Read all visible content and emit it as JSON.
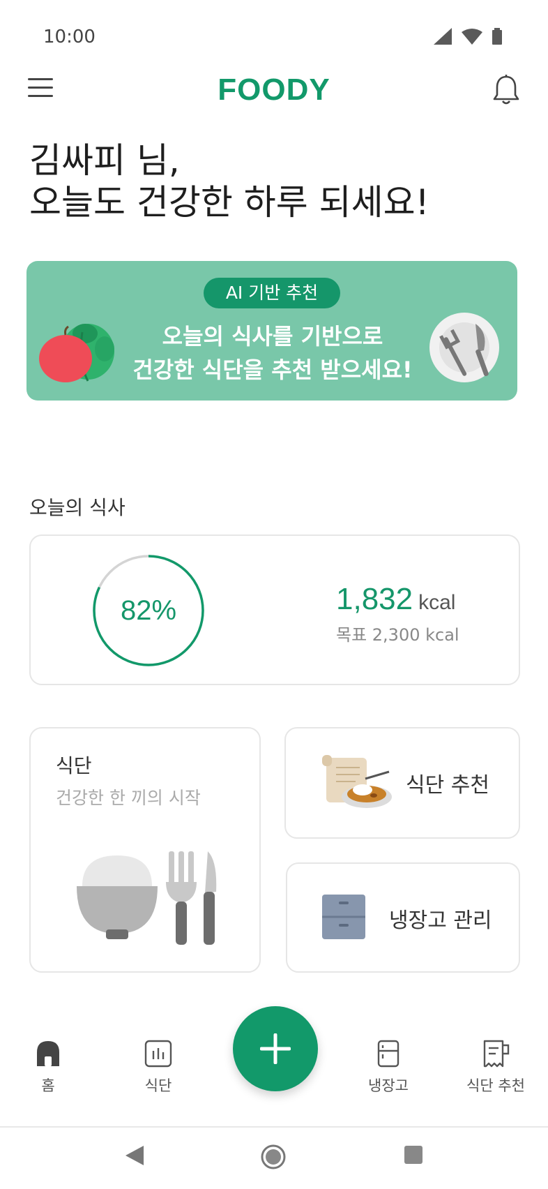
{
  "status_bar": {
    "time": "10:00"
  },
  "header": {
    "logo": "FOODY"
  },
  "greeting": {
    "line1": "김싸피 님,",
    "line2": "오늘도 건강한 하루 되세요!"
  },
  "banner": {
    "chip": "AI 기반 추천",
    "line1": "오늘의 식사를 기반으로",
    "line2": "건강한 식단을 추천 받으세요!"
  },
  "today_meal": {
    "section_title": "오늘의 식사",
    "progress_percent": 82,
    "progress_label": "82%",
    "kcal_value": "1,832",
    "kcal_unit": "kcal",
    "goal_text": "목표 2,300 kcal"
  },
  "diet_card": {
    "title": "식단",
    "subtitle": "건강한 한 끼의 시작"
  },
  "recommend_card": {
    "label": "식단 추천"
  },
  "fridge_card": {
    "label": "냉장고 관리"
  },
  "bottom_nav": {
    "items": [
      {
        "label": "홈",
        "icon": "home-icon"
      },
      {
        "label": "식단",
        "icon": "chart-icon"
      },
      {
        "label": "냉장고",
        "icon": "fridge-icon"
      },
      {
        "label": "식단 추천",
        "icon": "receipt-icon"
      }
    ],
    "fab_icon": "plus-icon"
  },
  "colors": {
    "brand": "#12996a",
    "banner_bg": "#79c7a9",
    "chip_bg": "#15966a"
  }
}
